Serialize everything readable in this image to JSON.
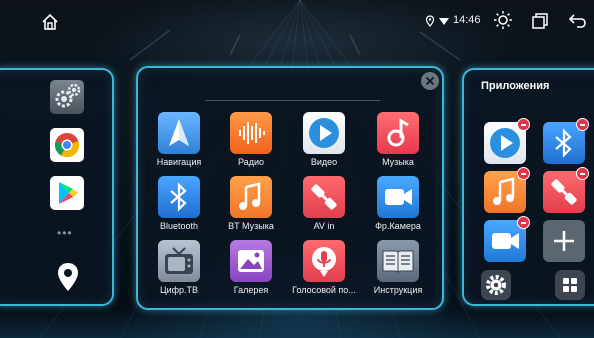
{
  "statusbar": {
    "time": "14:46",
    "icons": [
      "home-icon",
      "location-icon",
      "wifi-icon",
      "brightness-icon",
      "recent-apps-icon",
      "back-icon"
    ]
  },
  "dock": {
    "items": [
      {
        "icon": "settings-icon"
      },
      {
        "icon": "chrome-icon"
      },
      {
        "icon": "play-store-icon"
      }
    ],
    "more": "•••",
    "navigation_icon": "location-pin-icon"
  },
  "apps": [
    {
      "label": "Навигация",
      "icon": "navigation-icon",
      "color": "#2f7fd6"
    },
    {
      "label": "Радио",
      "icon": "radio-icon",
      "color": "#f07a2a"
    },
    {
      "label": "Видео",
      "icon": "video-icon",
      "color": "#2b8fe0"
    },
    {
      "label": "Музыка",
      "icon": "music-icon",
      "color": "#e8484e"
    },
    {
      "label": "Bluetooth",
      "icon": "bluetooth-icon",
      "color": "#2a7fde"
    },
    {
      "label": "BT Музыка",
      "icon": "bt-music-icon",
      "color": "#f08a2a"
    },
    {
      "label": "AV in",
      "icon": "av-in-icon",
      "color": "#e84850"
    },
    {
      "label": "Фр.Камера",
      "icon": "front-camera-icon",
      "color": "#2a90e0"
    },
    {
      "label": "Цифр.ТВ",
      "icon": "digital-tv-icon",
      "color": "#8a98a8"
    },
    {
      "label": "Галерея",
      "icon": "gallery-icon",
      "color": "#9a56c8"
    },
    {
      "label": "Голосовой по...",
      "icon": "voice-assistant-icon",
      "color": "#e8484e"
    },
    {
      "label": "Инструкция",
      "icon": "manual-icon",
      "color": "#6a7a8a"
    }
  ],
  "favorites": {
    "title": "Приложения",
    "items": [
      {
        "icon": "video-icon"
      },
      {
        "icon": "bluetooth-icon"
      },
      {
        "icon": "bt-music-icon"
      },
      {
        "icon": "av-in-icon"
      },
      {
        "icon": "front-camera-icon"
      }
    ],
    "add_icon": "plus-icon",
    "settings_icon": "gear-icon",
    "grid_icon": "grid-icon"
  },
  "colors": {
    "panel_border": "#3fb6d8",
    "badge_remove": "#e0344a"
  }
}
